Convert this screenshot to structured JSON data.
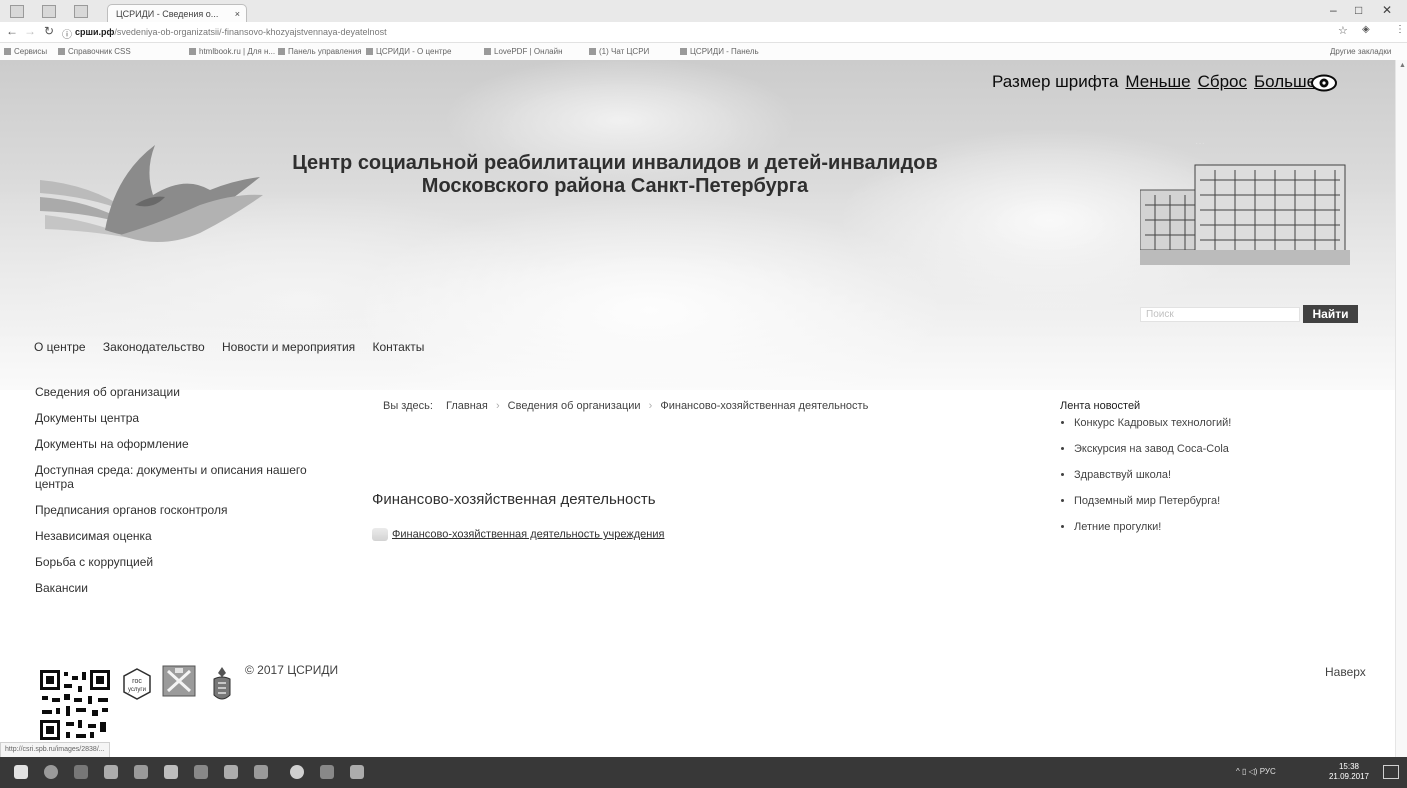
{
  "browser": {
    "tab_title": "ЦСРИДИ - Сведения о...",
    "tab_close": "×",
    "window_controls": [
      "–",
      "□",
      "✕"
    ],
    "url_host": "срши.рф",
    "url_path": "/svedeniya-ob-organizatsii/-finansovo-khozyajstvennaya-deyatelnost",
    "bookmarks": [
      "Сервисы",
      "Справочник CSS",
      "htmlbook.ru | Для н...",
      "Панель управления",
      "ЦСРИДИ - О центре",
      "LovePDF | Онлайн",
      "(1) Чат ЦСРИ",
      "ЦСРИДИ - Панель"
    ],
    "other_bookmarks": "Другие закладки"
  },
  "header": {
    "font_size_label": "Размер шрифта",
    "font_smaller": "Меньше",
    "font_reset": "Сброс",
    "font_bigger": "Больше",
    "title_line1": "Центр социальной реабилитации инвалидов и детей-инвалидов",
    "title_line2": "Московского района Санкт-Петербурга",
    "search_placeholder": "Поиск",
    "search_button": "Найти"
  },
  "topnav": [
    "О центре",
    "Законодательство",
    "Новости и мероприятия",
    "Контакты"
  ],
  "sidebar": [
    "Сведения об организации",
    "Документы центра",
    "Документы на оформление",
    "Доступная среда: документы и описания нашего центра",
    "Предписания органов госконтроля",
    "Независимая оценка",
    "Борьба с коррупцией",
    "Вакансии"
  ],
  "breadcrumb": {
    "prefix": "Вы здесь:",
    "items": [
      "Главная",
      "Сведения об организации",
      "Финансово-хозяйственная деятельность"
    ]
  },
  "main": {
    "heading": "Финансово-хозяйственная деятельность",
    "doc_link": "Финансово-хозяйственная деятельность учреждения"
  },
  "news": {
    "heading": "Лента новостей",
    "items": [
      "Конкурс Кадровых технологий!",
      "Экскурсия на завод Coca-Cola",
      "Здравствуй школа!",
      "Подземный мир Петербурга!",
      "Летние прогулки!"
    ]
  },
  "footer": {
    "copyright": "© 2017 ЦСРИДИ",
    "to_top": "Наверх",
    "gosuslugi_label": "гос услуги",
    "status_url": "http://csri.spb.ru/images/2838/..."
  },
  "taskbar": {
    "tray_lang": "РУС",
    "time": "15:38",
    "date": "21.09.2017"
  }
}
